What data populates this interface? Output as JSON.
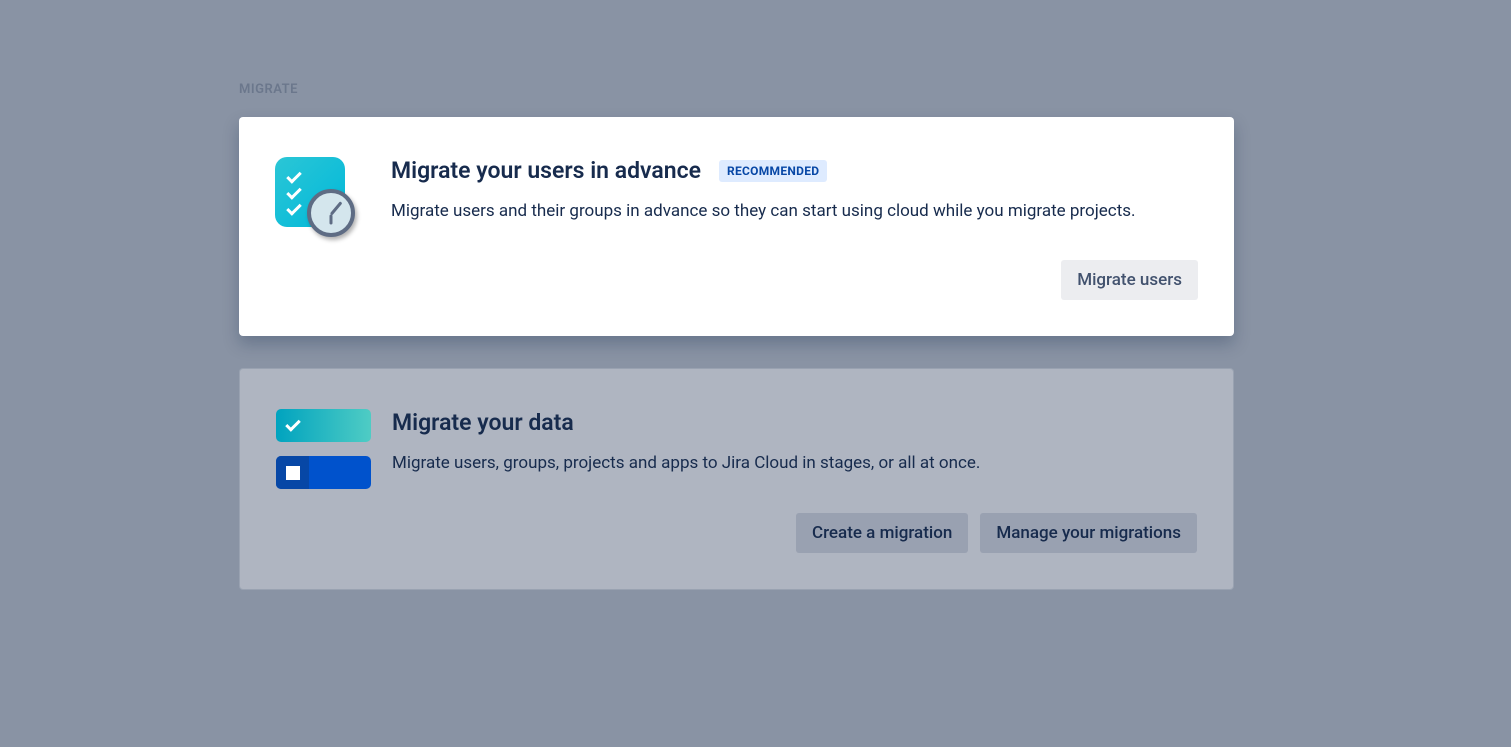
{
  "section_label": "MIGRATE",
  "cards": [
    {
      "title": "Migrate your users in advance",
      "badge": "RECOMMENDED",
      "description": "Migrate users and their groups in advance so they can start using cloud while you migrate projects.",
      "actions": [
        "Migrate users"
      ]
    },
    {
      "title": "Migrate your data",
      "badge": null,
      "description": "Migrate users, groups, projects and apps to Jira Cloud in stages, or all at once.",
      "actions": [
        "Create a migration",
        "Manage your migrations"
      ]
    }
  ]
}
